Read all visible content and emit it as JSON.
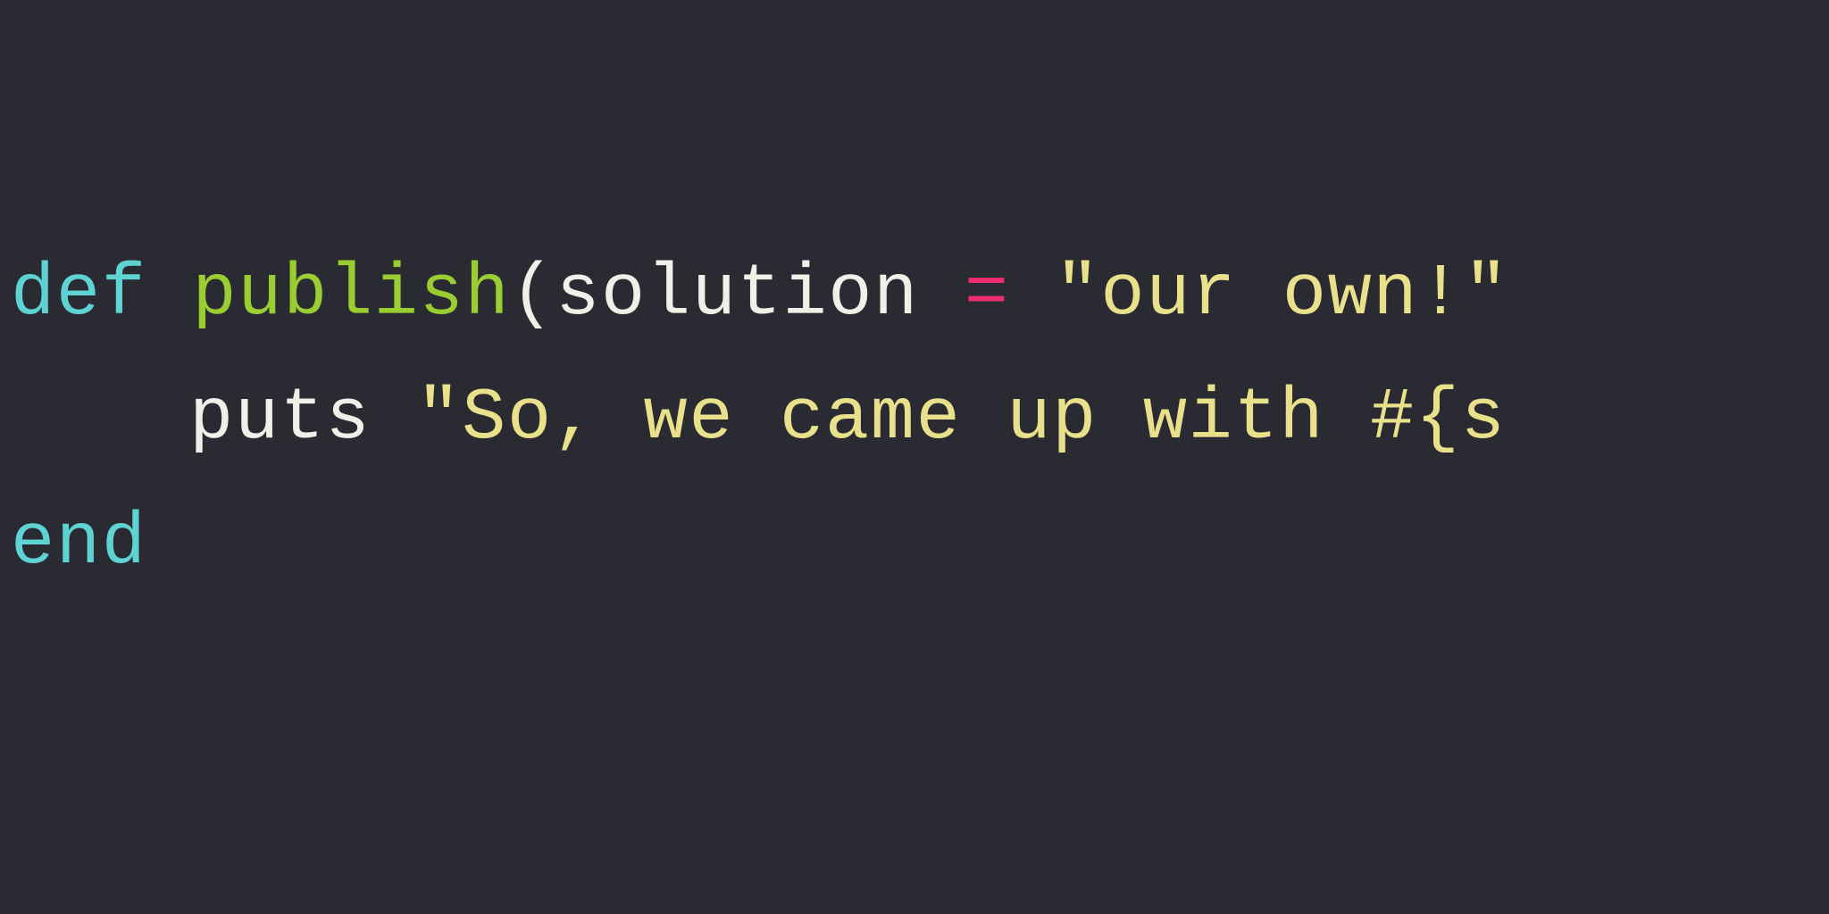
{
  "code": {
    "line1": {
      "keyword_def": "def",
      "method_name": "publish",
      "paren_open": "(",
      "param_name": "solution",
      "operator_eq": "=",
      "string_default": "\"our own!\"",
      "paren_close": ""
    },
    "line2": {
      "call": "puts",
      "string_part1": "\"So, we came up with ",
      "interp_open": "#{",
      "interp_var": "s"
    },
    "line3": {
      "keyword_end": "end"
    }
  }
}
